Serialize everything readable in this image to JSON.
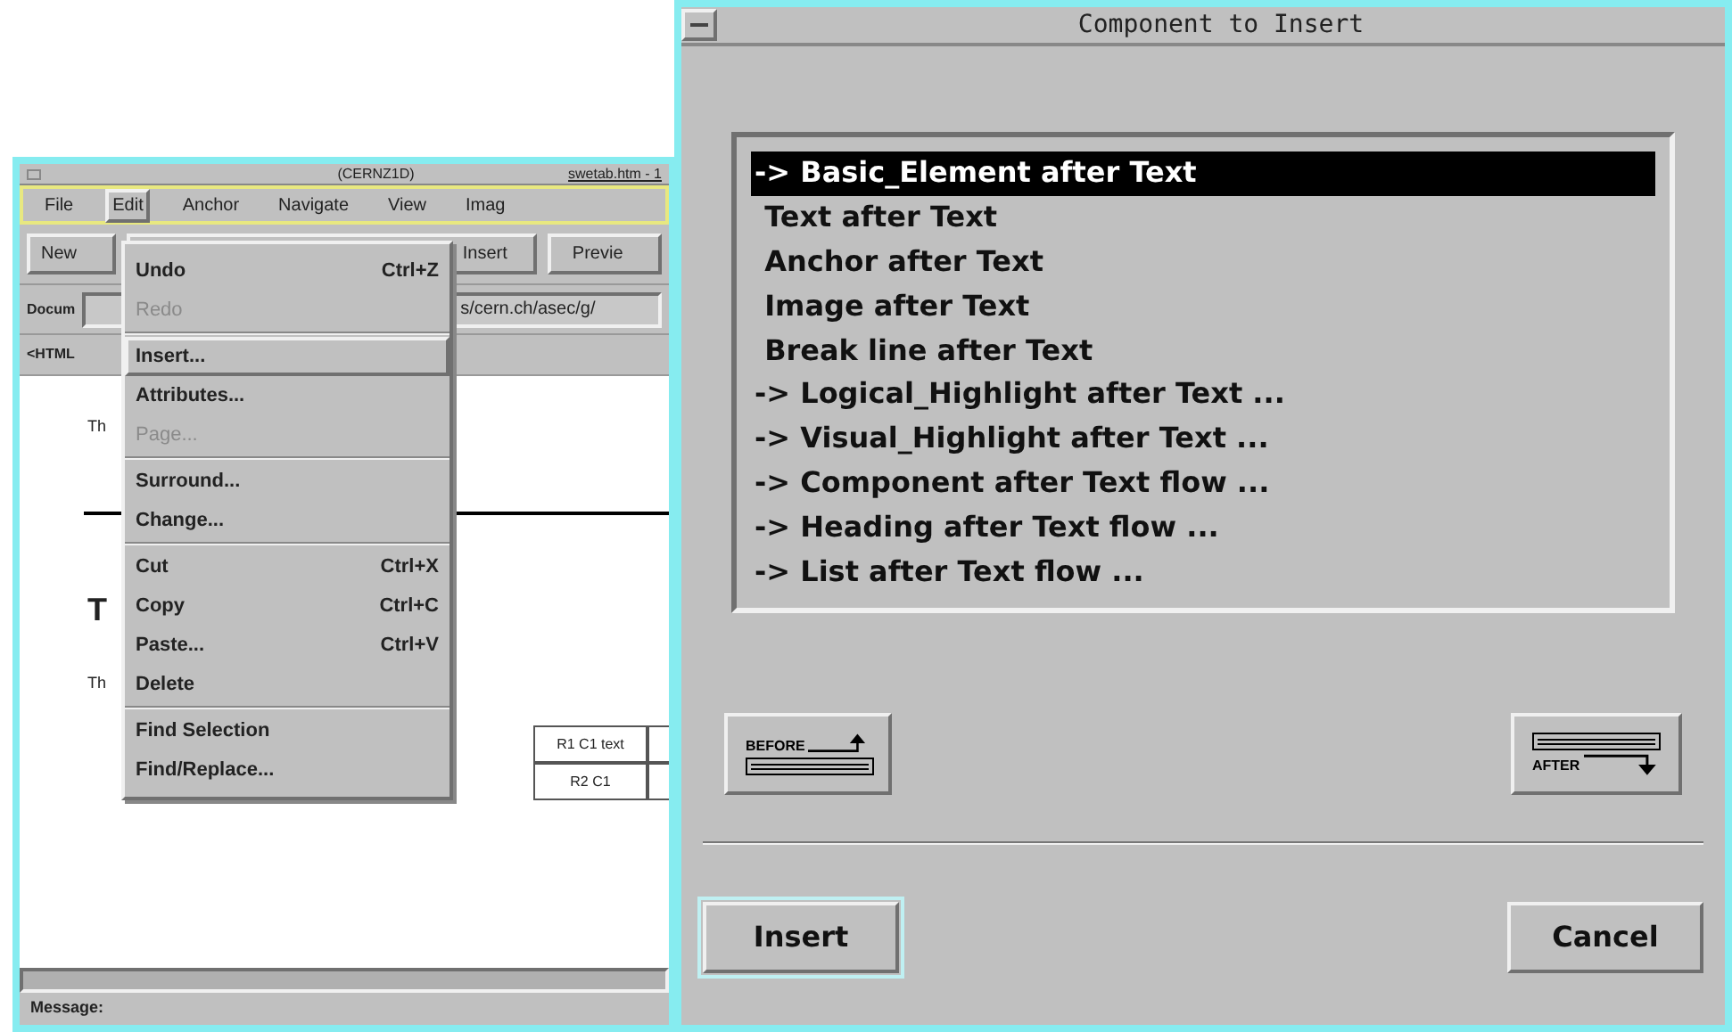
{
  "editor_window": {
    "title": "(CERNZ1D)",
    "filename": "swetab.htm - 1",
    "menubar": [
      {
        "label": "File",
        "selected": false
      },
      {
        "label": "Edit",
        "selected": true
      },
      {
        "label": "Anchor",
        "selected": false
      },
      {
        "label": "Navigate",
        "selected": false
      },
      {
        "label": "View",
        "selected": false
      },
      {
        "label": "Imag",
        "selected": false
      }
    ],
    "toolbar": [
      "New",
      "Insert",
      "Previe"
    ],
    "document_label": "Docum",
    "document_url": "s/cern.ch/asec/g/",
    "breadcrumb": "<HTML",
    "content": [
      {
        "kind": "text",
        "text": "Th"
      },
      {
        "kind": "rule"
      },
      {
        "kind": "heading",
        "text": "T"
      },
      {
        "kind": "text",
        "text": "Th"
      }
    ],
    "table": {
      "rows": [
        [
          "R1 C1 text",
          ""
        ],
        [
          "R2 C1",
          ""
        ]
      ]
    },
    "status": "Message:"
  },
  "edit_menu": [
    {
      "kind": "item",
      "label": "Undo",
      "shortcut": "Ctrl+Z",
      "disabled": false,
      "selected": false
    },
    {
      "kind": "item",
      "label": "Redo",
      "disabled": true,
      "selected": false
    },
    {
      "kind": "separator"
    },
    {
      "kind": "item",
      "label": "Insert...",
      "disabled": false,
      "selected": true
    },
    {
      "kind": "item",
      "label": "Attributes...",
      "disabled": false,
      "selected": false
    },
    {
      "kind": "item",
      "label": "Page...",
      "disabled": true,
      "selected": false
    },
    {
      "kind": "separator"
    },
    {
      "kind": "item",
      "label": "Surround...",
      "disabled": false,
      "selected": false
    },
    {
      "kind": "item",
      "label": "Change...",
      "disabled": false,
      "selected": false
    },
    {
      "kind": "separator"
    },
    {
      "kind": "item",
      "label": "Cut",
      "shortcut": "Ctrl+X",
      "disabled": false,
      "selected": false
    },
    {
      "kind": "item",
      "label": "Copy",
      "shortcut": "Ctrl+C",
      "disabled": false,
      "selected": false
    },
    {
      "kind": "item",
      "label": "Paste...",
      "shortcut": "Ctrl+V",
      "disabled": false,
      "selected": false
    },
    {
      "kind": "item",
      "label": "Delete",
      "disabled": false,
      "selected": false
    },
    {
      "kind": "separator"
    },
    {
      "kind": "item",
      "label": "Find Selection",
      "disabled": false,
      "selected": false
    },
    {
      "kind": "item",
      "label": "Find/Replace...",
      "disabled": false,
      "selected": false
    }
  ],
  "dialog": {
    "title": "Component to Insert",
    "items": [
      {
        "label": "-> Basic_Element after Text",
        "selected": true
      },
      {
        "label": " Text after Text",
        "selected": false
      },
      {
        "label": " Anchor after Text",
        "selected": false
      },
      {
        "label": " Image after Text",
        "selected": false
      },
      {
        "label": " Break line after Text",
        "selected": false
      },
      {
        "label": "-> Logical_Highlight after Text ...",
        "selected": false
      },
      {
        "label": "-> Visual_Highlight after Text ...",
        "selected": false
      },
      {
        "label": "-> Component after Text flow ...",
        "selected": false
      },
      {
        "label": "-> Heading after Text flow ...",
        "selected": false
      },
      {
        "label": "-> List after Text flow ...",
        "selected": false
      }
    ],
    "before_label": "BEFORE",
    "after_label": "AFTER",
    "buttons": [
      {
        "label": "Insert",
        "kind": "default"
      },
      {
        "label": "Cancel",
        "kind": "normal"
      }
    ]
  }
}
